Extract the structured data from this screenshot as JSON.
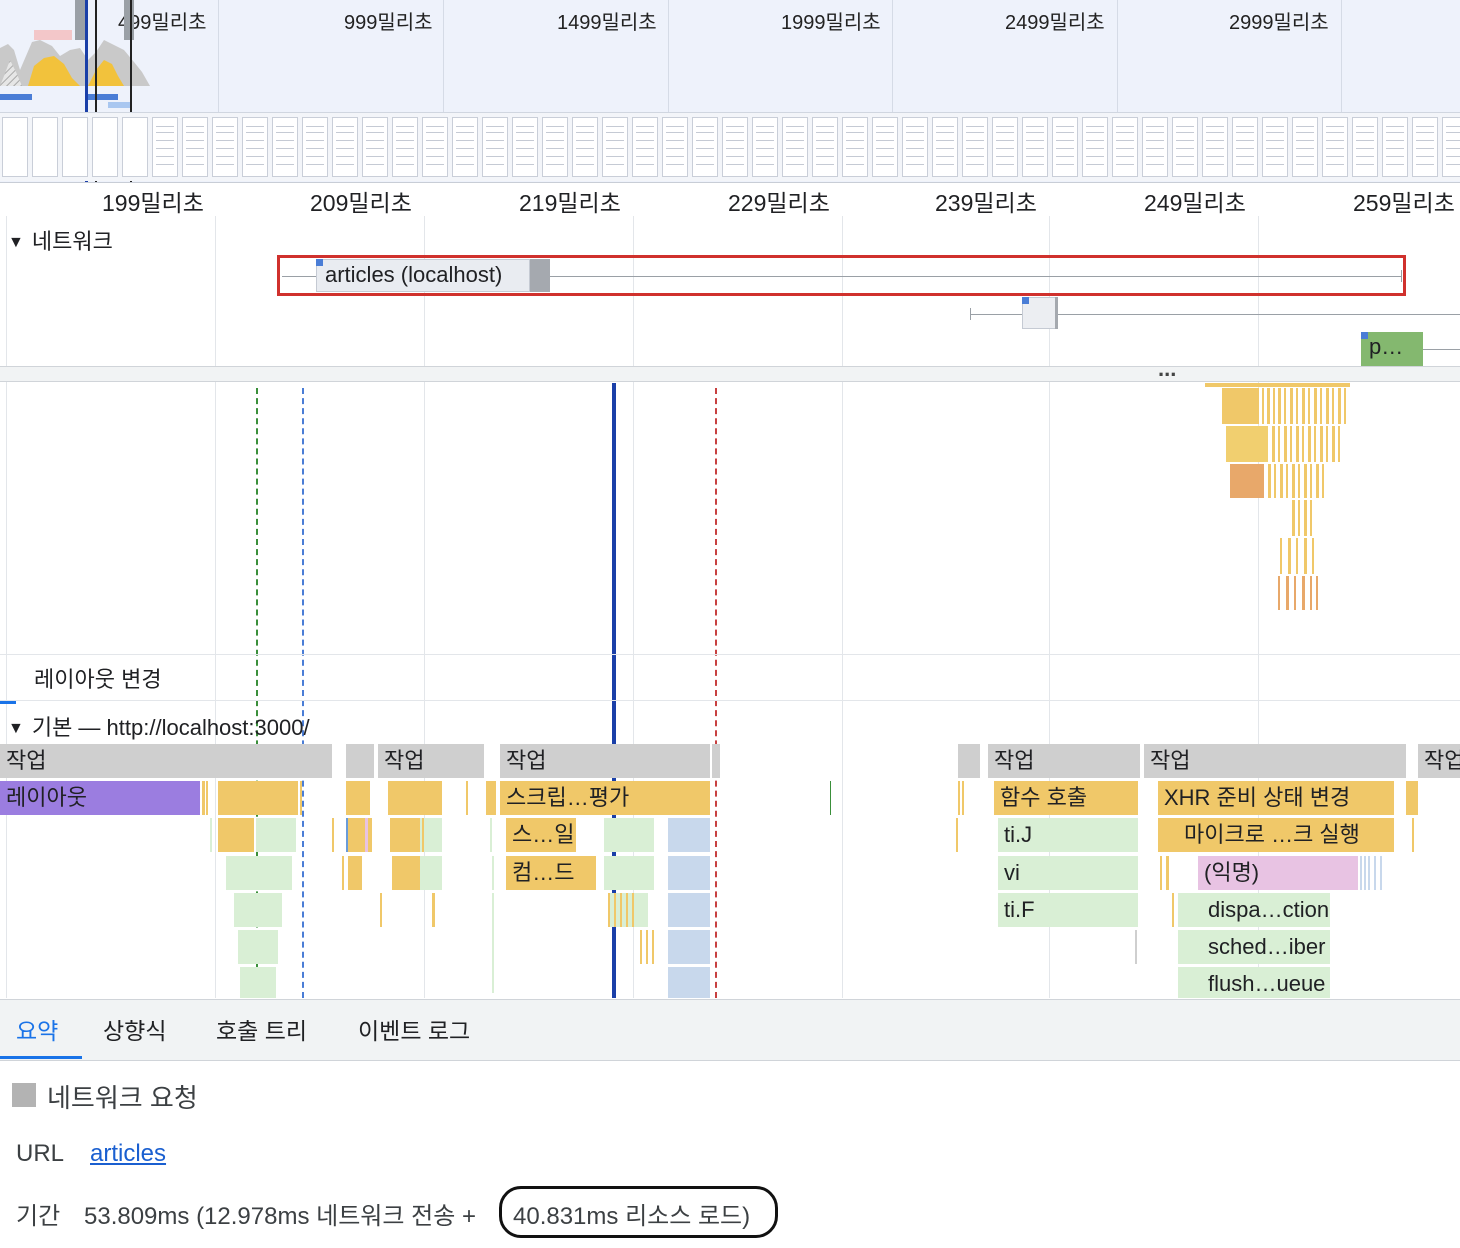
{
  "overview": {
    "tick_labels": [
      "499밀리초",
      "999밀리초",
      "1499밀리초",
      "1999밀리초",
      "2499밀리초",
      "2999밀리초"
    ]
  },
  "ruler": {
    "labels": [
      "199밀리초",
      "209밀리초",
      "219밀리초",
      "229밀리초",
      "239밀리초",
      "249밀리초",
      "259밀리초"
    ]
  },
  "network": {
    "title": "네트워크",
    "request_label": "articles (localhost)",
    "small_request_label": "p…",
    "more": "..."
  },
  "tracks": {
    "layout_shift": "레이아웃 변경",
    "main_thread": "기본 — http://localhost:3000/"
  },
  "flame": {
    "task": "작업",
    "layout": "레이아웃",
    "script_eval": "스크립…평가",
    "s_il": "스…일",
    "compile": "컴…드",
    "function_call": "함수 호출",
    "ti_j": "ti.J",
    "vi": "vi",
    "ti_f": "ti.F",
    "xhr": "XHR 준비 상태 변경",
    "microtask": "마이크로 …크 실행",
    "anonymous": "(익명)",
    "dispatch": "dispa…ction",
    "sched": "sched…iber",
    "flush": "flush…ueue"
  },
  "tabs": [
    "요약",
    "상향식",
    "호출 트리",
    "이벤트 로그"
  ],
  "summary": {
    "heading": "네트워크 요청",
    "url_label": "URL",
    "url_value": "articles",
    "duration_label": "기간",
    "duration_value": "53.809ms (12.978ms 네트워크 전송 + ",
    "resource_load": "40.831ms 리소스 로드)"
  },
  "colors": {
    "highlight_red": "#d0312d",
    "accent_blue": "#1a73e8",
    "cursor_blue": "#1a3fa8"
  }
}
